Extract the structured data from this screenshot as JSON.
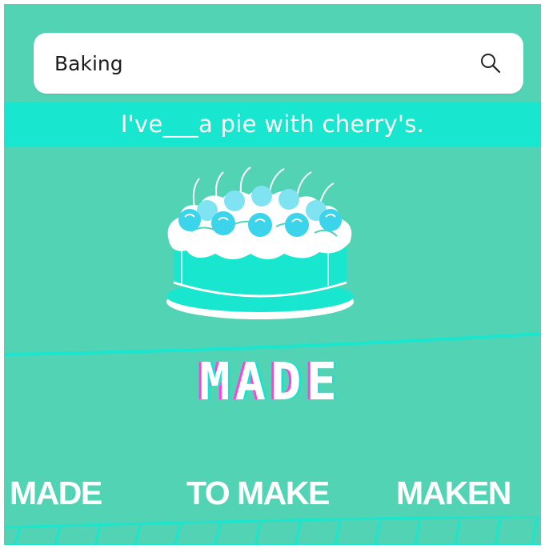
{
  "search": {
    "value": "Baking",
    "icon": "search-icon"
  },
  "question": {
    "sentence": "I've___a pie with cherry's."
  },
  "illustration": {
    "icon": "cherry-cake-icon"
  },
  "answer": {
    "word": "MADE"
  },
  "options": [
    {
      "label": "MADE"
    },
    {
      "label": "TO MAKE"
    },
    {
      "label": "MAKEN"
    }
  ],
  "colors": {
    "background": "#52d3b4",
    "prompt_bar": "#19e6cf",
    "accent_cyan": "#18e3d0",
    "accent_magenta": "#ff3fe0",
    "text_light": "#ffffff"
  }
}
